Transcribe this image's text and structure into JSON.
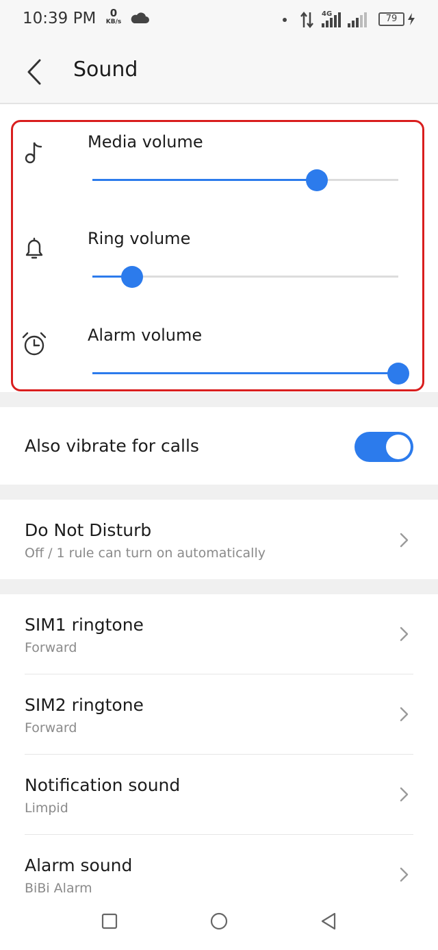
{
  "status_bar": {
    "time": "10:39 PM",
    "net_speed_value": "0",
    "net_speed_unit": "KB/s",
    "battery_level": "79",
    "network_type": "4G",
    "icons": [
      "cloud-icon",
      "dot-icon",
      "data-arrows-icon",
      "signal-icon",
      "battery-icon",
      "charging-icon"
    ]
  },
  "header": {
    "back_icon": "chevron-left-icon",
    "title": "Sound"
  },
  "volumes": [
    {
      "icon": "music-note-icon",
      "label": "Media volume",
      "level": 0.734
    },
    {
      "icon": "bell-icon",
      "label": "Ring volume",
      "level": 0.13
    },
    {
      "icon": "alarm-clock-icon",
      "label": "Alarm volume",
      "level": 1.0
    }
  ],
  "vibrate": {
    "label": "Also vibrate for calls",
    "enabled": true
  },
  "dnd": {
    "title": "Do Not Disturb",
    "subtitle": "Off / 1 rule can turn on automatically"
  },
  "ringtones": [
    {
      "title": "SIM1 ringtone",
      "subtitle": "Forward"
    },
    {
      "title": "SIM2 ringtone",
      "subtitle": "Forward"
    },
    {
      "title": "Notification sound",
      "subtitle": "Limpid"
    },
    {
      "title": "Alarm sound",
      "subtitle": "BiBi Alarm"
    }
  ],
  "colors": {
    "accent": "#2c7bec",
    "highlight_border": "#d91e1e"
  },
  "nav": [
    "recents-square-icon",
    "home-circle-icon",
    "back-triangle-icon"
  ]
}
